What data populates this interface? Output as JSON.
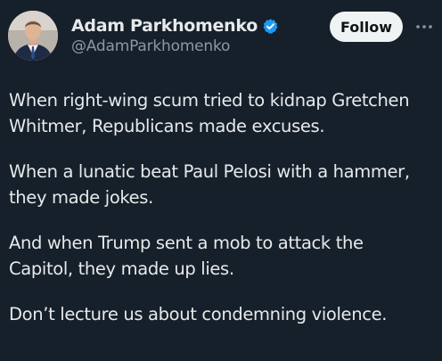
{
  "author": {
    "display_name": "Adam Parkhomenko",
    "handle": "@AdamParkhomenko",
    "avatar_icon": "user-avatar-photo",
    "verified_icon": "verified-badge-icon",
    "verified_color": "#1d9bf0"
  },
  "actions": {
    "follow_label": "Follow",
    "more_icon": "more-options-icon"
  },
  "tweet": {
    "paragraphs": [
      {
        "lines": [
          "When right-wing scum tried to kidnap Gretchen",
          "Whitmer, Republicans made excuses."
        ]
      },
      {
        "lines": [
          "When a lunatic beat Paul Pelosi with a hammer,",
          "they made jokes."
        ]
      },
      {
        "lines": [
          "And when Trump sent a mob to attack the",
          "Capitol, they made up lies."
        ]
      },
      {
        "lines": [
          "Don’t lecture us about condemning violence."
        ]
      }
    ]
  },
  "colors": {
    "background": "#15202b",
    "text_primary": "#e7e9ea",
    "text_secondary": "#8b98a5",
    "button_bg": "#eff3f4",
    "button_text": "#0f1419"
  }
}
